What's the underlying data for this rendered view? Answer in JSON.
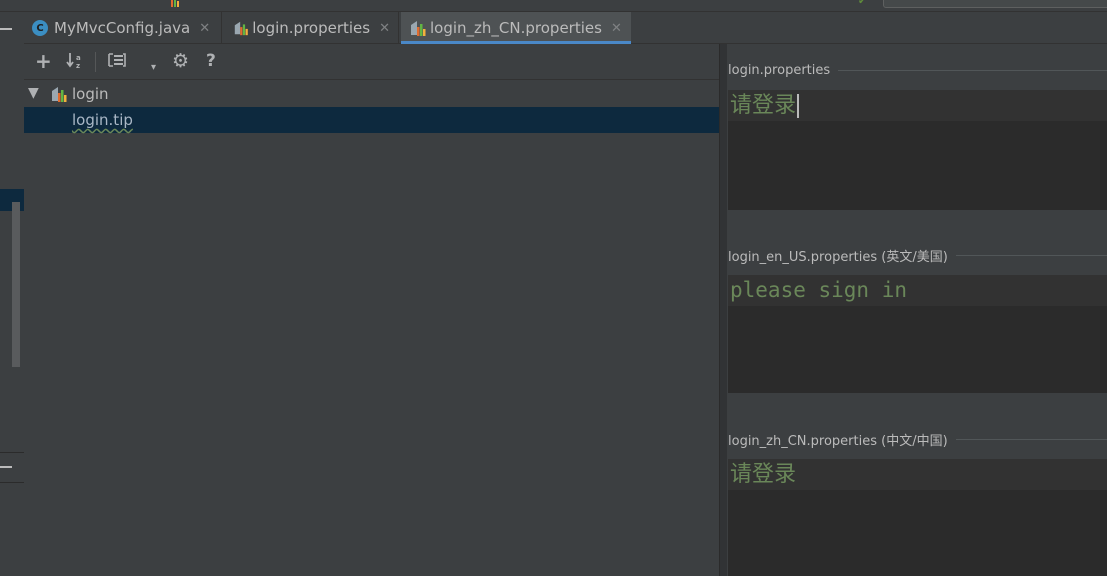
{
  "tabs": [
    {
      "label": "MyMvcConfig.java",
      "icon": "java-class-icon",
      "active": false
    },
    {
      "label": "login.properties",
      "icon": "resource-bundle-icon",
      "active": false
    },
    {
      "label": "login_zh_CN.properties",
      "icon": "resource-bundle-icon",
      "active": true
    }
  ],
  "toolbar": {
    "add": "+",
    "sort": "↓",
    "settings": "⚙",
    "help": "?"
  },
  "tree": {
    "root_label": "login",
    "child_label": "login.tip"
  },
  "properties": [
    {
      "file": "login.properties",
      "value": "请登录"
    },
    {
      "file": "login_en_US.properties (英文/美国)",
      "value": "please sign in"
    },
    {
      "file": "login_zh_CN.properties (中文/中国)",
      "value": "请登录"
    }
  ],
  "colors": {
    "accent": "#4a88c7",
    "selection": "#0d293e",
    "string_value": "#6a8759"
  }
}
